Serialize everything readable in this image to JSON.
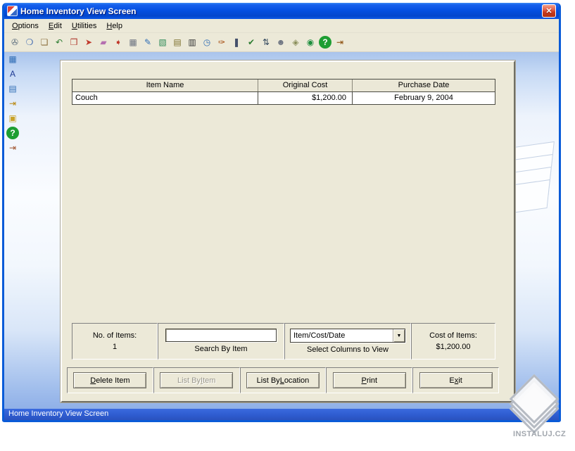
{
  "window": {
    "title": "Home Inventory View Screen",
    "close_glyph": "✕"
  },
  "colors": {
    "frame_blue": "#0A5BD8",
    "titlebar_blue": "#0550E2",
    "panel_beige": "#ECE9D8",
    "statusbar_blue": "#2E5BCE",
    "close_red": "#C93A1D",
    "help_green": "#1E9E33",
    "disabled_text": "#9B988D"
  },
  "menu": {
    "items": [
      {
        "pre": "",
        "accel": "O",
        "post": "ptions"
      },
      {
        "pre": "",
        "accel": "E",
        "post": "dit"
      },
      {
        "pre": "",
        "accel": "U",
        "post": "tilities"
      },
      {
        "pre": "",
        "accel": "H",
        "post": "elp"
      }
    ]
  },
  "toolbar": {
    "icons": [
      {
        "name": "print-icon",
        "glyph": "✇",
        "color": "#5A6B7C"
      },
      {
        "name": "search-icon",
        "glyph": "❍",
        "color": "#3A66B0"
      },
      {
        "name": "stamp-icon",
        "glyph": "❏",
        "color": "#8A6D3B"
      },
      {
        "name": "undo-icon",
        "glyph": "↶",
        "color": "#2E7D32"
      },
      {
        "name": "books-icon",
        "glyph": "❒",
        "color": "#B03A2E"
      },
      {
        "name": "car-icon",
        "glyph": "➤",
        "color": "#C0392B"
      },
      {
        "name": "eraser-icon",
        "glyph": "▰",
        "color": "#B56FB0"
      },
      {
        "name": "truck-icon",
        "glyph": "➧",
        "color": "#C0392B"
      },
      {
        "name": "building-icon",
        "glyph": "▦",
        "color": "#6B7280"
      },
      {
        "name": "edit-note-icon",
        "glyph": "✎",
        "color": "#2F6DB5"
      },
      {
        "name": "chart-icon",
        "glyph": "▧",
        "color": "#2E8B57"
      },
      {
        "name": "notepad-icon",
        "glyph": "▤",
        "color": "#7C6F2C"
      },
      {
        "name": "barcode-icon",
        "glyph": "▥",
        "color": "#333333"
      },
      {
        "name": "clock-icon",
        "glyph": "◷",
        "color": "#2F6DB5"
      },
      {
        "name": "brush-icon",
        "glyph": "✑",
        "color": "#A04000"
      },
      {
        "name": "columns-icon",
        "glyph": "❚",
        "color": "#44506B"
      },
      {
        "name": "check-icon",
        "glyph": "✔",
        "color": "#2E7D32"
      },
      {
        "name": "sort-icon",
        "glyph": "⇅",
        "color": "#34495E"
      },
      {
        "name": "user-icon",
        "glyph": "☻",
        "color": "#6B7280"
      },
      {
        "name": "lock-icon",
        "glyph": "◈",
        "color": "#8A8F5A"
      },
      {
        "name": "globe-icon",
        "glyph": "◉",
        "color": "#1E8E3E"
      },
      {
        "name": "help-icon",
        "glyph": "?",
        "color": "#FFFFFF",
        "bg": "#1E9E33"
      },
      {
        "name": "exit-icon",
        "glyph": "⇥",
        "color": "#8A4B08"
      }
    ]
  },
  "sidebar": {
    "icons": [
      {
        "name": "grid-icon",
        "glyph": "▦",
        "color": "#2F6DB5"
      },
      {
        "name": "font-icon",
        "glyph": "A",
        "color": "#1F3A93"
      },
      {
        "name": "list-icon",
        "glyph": "▤",
        "color": "#2F6DB5"
      },
      {
        "name": "door-icon",
        "glyph": "⇥",
        "color": "#B8860B"
      },
      {
        "name": "photo-icon",
        "glyph": "▣",
        "color": "#C9A227"
      },
      {
        "name": "help-icon",
        "glyph": "?",
        "color": "#FFFFFF",
        "bg": "#1E9E33"
      },
      {
        "name": "exit-icon",
        "glyph": "⇥",
        "color": "#A0522D"
      }
    ]
  },
  "table": {
    "headers": [
      "Item Name",
      "Original Cost",
      "Purchase Date"
    ],
    "rows": [
      [
        "Couch",
        "$1,200.00",
        "February 9, 2004"
      ]
    ]
  },
  "info_bar": {
    "items_label": "No. of Items:",
    "items_value": "1",
    "search_value": "",
    "search_label": "Search By Item",
    "columns_value": "Item/Cost/Date",
    "dropdown_arrow": "▼",
    "columns_label": "Select Columns to View",
    "cost_label": "Cost of Items:",
    "cost_value": "$1,200.00"
  },
  "buttons": [
    {
      "pre": "",
      "accel": "D",
      "post": "elete Item",
      "enabled": true
    },
    {
      "pre": "List By ",
      "accel": "I",
      "post": "tem",
      "enabled": false
    },
    {
      "pre": "List By ",
      "accel": "L",
      "post": "ocation",
      "enabled": true
    },
    {
      "pre": "",
      "accel": "P",
      "post": "rint",
      "enabled": true
    },
    {
      "pre": "E",
      "accel": "x",
      "post": "it",
      "enabled": true
    }
  ],
  "status_bar": {
    "text": "Home Inventory View Screen"
  },
  "watermark": {
    "text": "INSTALUJ.CZ"
  }
}
